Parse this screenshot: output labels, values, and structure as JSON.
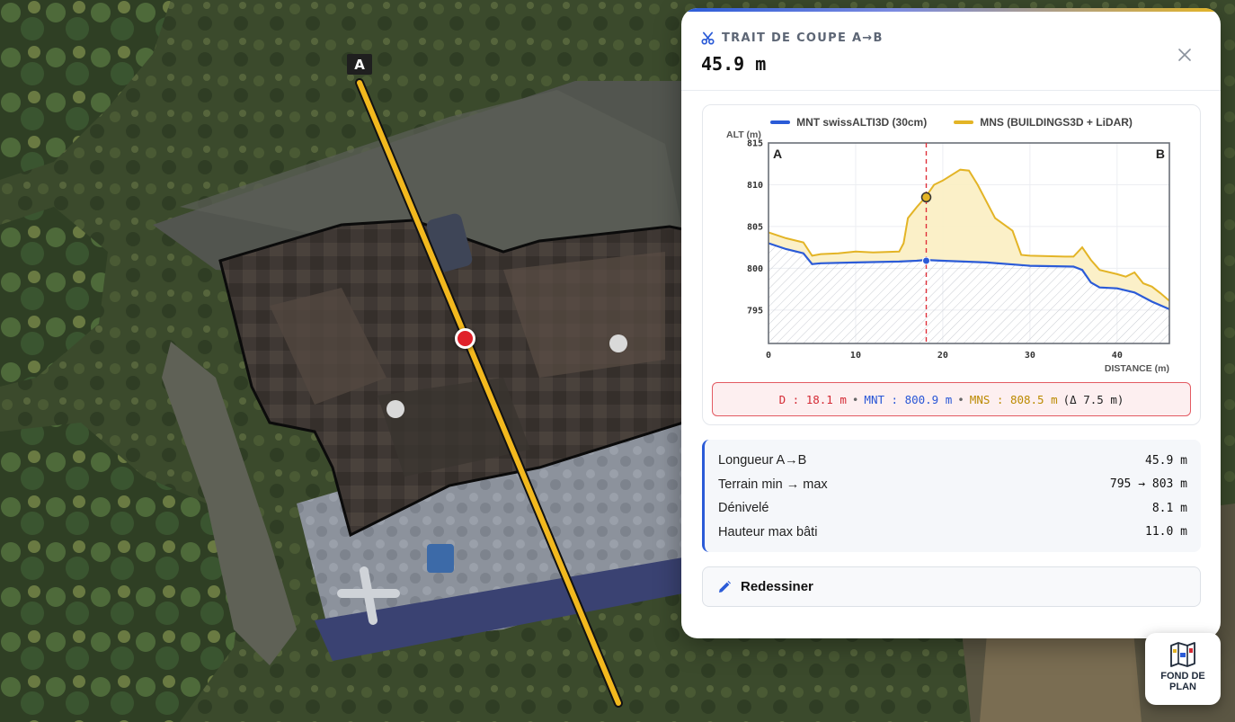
{
  "map": {
    "marker_a_label": "A"
  },
  "panel": {
    "kicker": "TRAIT DE COUPE A→B",
    "headline": "45.9 m",
    "close_icon": "close-icon",
    "accent_color": "#2b5bd7"
  },
  "chart_data": {
    "type": "area",
    "title": "",
    "ylabel": "ALT (m)",
    "xlabel": "DISTANCE (m)",
    "xlim": [
      0,
      46
    ],
    "ylim": [
      791,
      815
    ],
    "x_ticks": [
      0,
      10,
      20,
      30,
      40
    ],
    "y_ticks": [
      795,
      800,
      805,
      810,
      815
    ],
    "grid": true,
    "legend_position": "top",
    "start_label": "A",
    "end_label": "B",
    "cursor": {
      "x": 18.1,
      "mnt": 800.9,
      "mns": 808.5
    },
    "series": [
      {
        "name": "MNT swissALTI3D (30cm)",
        "color": "#2b5bd7",
        "x": [
          0,
          2,
          4,
          5,
          6,
          10,
          15,
          17,
          18,
          20,
          25,
          30,
          35,
          36,
          37,
          38,
          40,
          42,
          44,
          46
        ],
        "y": [
          803.0,
          802.3,
          801.8,
          800.5,
          800.6,
          800.7,
          800.8,
          800.9,
          801.0,
          800.9,
          800.7,
          800.3,
          800.2,
          799.8,
          798.3,
          797.7,
          797.6,
          797.1,
          796.0,
          795.1
        ]
      },
      {
        "name": "MNS (BUILDINGS3D + LiDAR)",
        "color": "#e3b426",
        "x": [
          0,
          2,
          4,
          5,
          6,
          8,
          10,
          12,
          15,
          15.5,
          16,
          17,
          18,
          19,
          20,
          22,
          23,
          24,
          26,
          28,
          29,
          30,
          34,
          35,
          36,
          37,
          38,
          40,
          41,
          42,
          43,
          44,
          45,
          46
        ],
        "y": [
          804.3,
          803.6,
          803.1,
          801.5,
          801.7,
          801.8,
          802.0,
          801.9,
          802.0,
          803.0,
          806.0,
          807.3,
          808.5,
          810.0,
          810.5,
          811.8,
          811.7,
          810.0,
          806.0,
          804.5,
          801.6,
          801.5,
          801.4,
          801.4,
          802.5,
          801.0,
          799.8,
          799.3,
          799.0,
          799.5,
          798.2,
          797.8,
          797.0,
          796.1
        ]
      }
    ]
  },
  "readout": {
    "d": "D : 18.1 m",
    "mnt": "MNT : 800.9 m",
    "mns": "MNS : 808.5 m",
    "delta": "(Δ 7.5 m)",
    "separator": "•"
  },
  "stats": [
    {
      "label": "Longueur A→B",
      "value": "45.9 m"
    },
    {
      "label": "Terrain min → max",
      "value": "795 → 803 m"
    },
    {
      "label": "Dénivelé",
      "value": "8.1 m"
    },
    {
      "label": "Hauteur max bâti",
      "value": "11.0 m"
    }
  ],
  "actions": {
    "redraw_label": "Redessiner",
    "redraw_icon": "pencil-icon"
  },
  "basemap": {
    "label": "FOND DE PLAN",
    "icon": "map-icon"
  }
}
